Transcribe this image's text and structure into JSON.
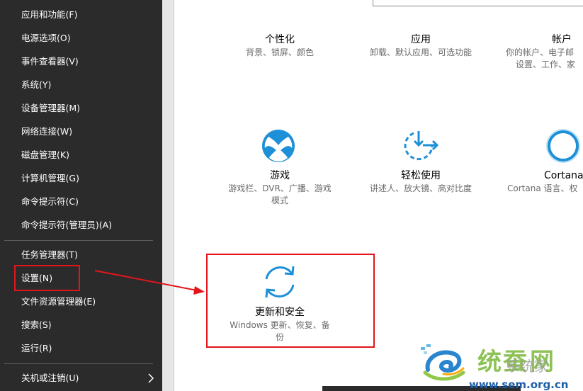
{
  "winx_menu": {
    "items": [
      {
        "label": "应用和功能(F)"
      },
      {
        "label": "电源选项(O)"
      },
      {
        "label": "事件查看器(V)"
      },
      {
        "label": "系统(Y)"
      },
      {
        "label": "设备管理器(M)"
      },
      {
        "label": "网络连接(W)"
      },
      {
        "label": "磁盘管理(K)"
      },
      {
        "label": "计算机管理(G)"
      },
      {
        "label": "命令提示符(C)"
      },
      {
        "label": "命令提示符(管理员)(A)"
      },
      {
        "label": "任务管理器(T)"
      },
      {
        "label": "设置(N)"
      },
      {
        "label": "文件资源管理器(E)"
      },
      {
        "label": "搜索(S)"
      },
      {
        "label": "运行(R)"
      },
      {
        "label": "关机或注销(U)"
      }
    ],
    "submenu_icon": "chevron-right-icon"
  },
  "settings_tiles": {
    "personalization": {
      "title": "个性化",
      "desc": "背景、锁屏、颜色"
    },
    "apps": {
      "title": "应用",
      "desc": "卸载、默认应用、可选功能"
    },
    "accounts": {
      "title": "帐户",
      "desc_line1": "你的帐户、电子邮",
      "desc_line2": "设置、工作、家"
    },
    "gaming": {
      "title": "游戏",
      "desc_line1": "游戏栏、DVR、广播、游戏",
      "desc_line2": "模式",
      "icon": "xbox-icon"
    },
    "ease_of_access": {
      "title": "轻松使用",
      "desc": "讲述人、放大镜、高对比度",
      "icon": "ease-of-access-icon"
    },
    "cortana": {
      "title": "Cortana",
      "desc": "Cortana 语言、权",
      "icon": "cortana-ring-icon"
    },
    "update_security": {
      "title": "更新和安全",
      "desc_line1": "Windows 更新、恢复、备",
      "desc_line2": "份",
      "icon": "sync-arrows-icon"
    }
  },
  "colors": {
    "accent": "#1e90d8",
    "highlight": "#e3151a",
    "menu_bg": "#2b2b2b"
  },
  "watermark": {
    "brand": "系统家",
    "url": "www.sem.org.cn"
  }
}
